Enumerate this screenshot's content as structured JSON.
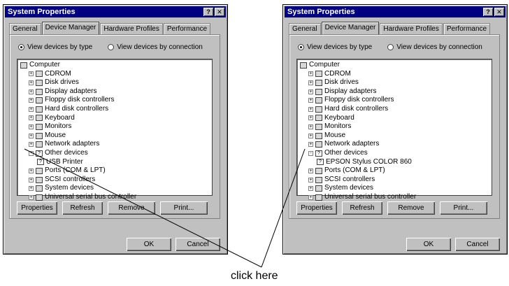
{
  "caption": "click here",
  "windows": [
    {
      "title": "System Properties",
      "tabs": [
        "General",
        "Device Manager",
        "Hardware Profiles",
        "Performance"
      ],
      "active_tab": "Device Manager",
      "radio_by_type": "View devices by type",
      "radio_by_connection": "View devices by connection",
      "tree": [
        {
          "label": "Computer",
          "level": 0,
          "icon": "computer-icon",
          "exp": ""
        },
        {
          "label": "CDROM",
          "level": 1,
          "icon": "cdrom-icon",
          "exp": "+"
        },
        {
          "label": "Disk drives",
          "level": 1,
          "icon": "disk-icon",
          "exp": "+"
        },
        {
          "label": "Display adapters",
          "level": 1,
          "icon": "display-icon",
          "exp": "+"
        },
        {
          "label": "Floppy disk controllers",
          "level": 1,
          "icon": "floppy-icon",
          "exp": "+"
        },
        {
          "label": "Hard disk controllers",
          "level": 1,
          "icon": "harddisk-icon",
          "exp": "+"
        },
        {
          "label": "Keyboard",
          "level": 1,
          "icon": "keyboard-icon",
          "exp": "+"
        },
        {
          "label": "Monitors",
          "level": 1,
          "icon": "monitor-icon",
          "exp": "+"
        },
        {
          "label": "Mouse",
          "level": 1,
          "icon": "mouse-icon",
          "exp": "+"
        },
        {
          "label": "Network adapters",
          "level": 1,
          "icon": "network-icon",
          "exp": "+"
        },
        {
          "label": "Other devices",
          "level": 1,
          "icon": "question-icon",
          "exp": "-"
        },
        {
          "label": "USB Printer",
          "level": 2,
          "icon": "question-icon",
          "exp": ""
        },
        {
          "label": "Ports (COM & LPT)",
          "level": 1,
          "icon": "port-icon",
          "exp": "+"
        },
        {
          "label": "SCSI controllers",
          "level": 1,
          "icon": "scsi-icon",
          "exp": "+"
        },
        {
          "label": "System devices",
          "level": 1,
          "icon": "system-icon",
          "exp": "+"
        },
        {
          "label": "Universal serial bus controller",
          "level": 1,
          "icon": "usb-icon",
          "exp": "+"
        }
      ],
      "buttons": [
        "Properties",
        "Refresh",
        "Remove",
        "Print..."
      ],
      "ok": "OK",
      "cancel": "Cancel"
    },
    {
      "title": "System Properties",
      "tabs": [
        "General",
        "Device Manager",
        "Hardware Profiles",
        "Performance"
      ],
      "active_tab": "Device Manager",
      "radio_by_type": "View devices by type",
      "radio_by_connection": "View devices by connection",
      "tree": [
        {
          "label": "Computer",
          "level": 0,
          "icon": "computer-icon",
          "exp": ""
        },
        {
          "label": "CDROM",
          "level": 1,
          "icon": "cdrom-icon",
          "exp": "+"
        },
        {
          "label": "Disk drives",
          "level": 1,
          "icon": "disk-icon",
          "exp": "+"
        },
        {
          "label": "Display adapters",
          "level": 1,
          "icon": "display-icon",
          "exp": "+"
        },
        {
          "label": "Floppy disk controllers",
          "level": 1,
          "icon": "floppy-icon",
          "exp": "+"
        },
        {
          "label": "Hard disk controllers",
          "level": 1,
          "icon": "harddisk-icon",
          "exp": "+"
        },
        {
          "label": "Keyboard",
          "level": 1,
          "icon": "keyboard-icon",
          "exp": "+"
        },
        {
          "label": "Monitors",
          "level": 1,
          "icon": "monitor-icon",
          "exp": "+"
        },
        {
          "label": "Mouse",
          "level": 1,
          "icon": "mouse-icon",
          "exp": "+"
        },
        {
          "label": "Network adapters",
          "level": 1,
          "icon": "network-icon",
          "exp": "+"
        },
        {
          "label": "Other devices",
          "level": 1,
          "icon": "question-icon",
          "exp": "-"
        },
        {
          "label": "EPSON Stylus COLOR 860",
          "level": 2,
          "icon": "question-icon",
          "exp": ""
        },
        {
          "label": "Ports (COM & LPT)",
          "level": 1,
          "icon": "port-icon",
          "exp": "+"
        },
        {
          "label": "SCSI controllers",
          "level": 1,
          "icon": "scsi-icon",
          "exp": "+"
        },
        {
          "label": "System devices",
          "level": 1,
          "icon": "system-icon",
          "exp": "+"
        },
        {
          "label": "Universal serial bus controller",
          "level": 1,
          "icon": "usb-icon",
          "exp": "+"
        }
      ],
      "buttons": [
        "Properties",
        "Refresh",
        "Remove",
        "Print..."
      ],
      "ok": "OK",
      "cancel": "Cancel"
    }
  ]
}
